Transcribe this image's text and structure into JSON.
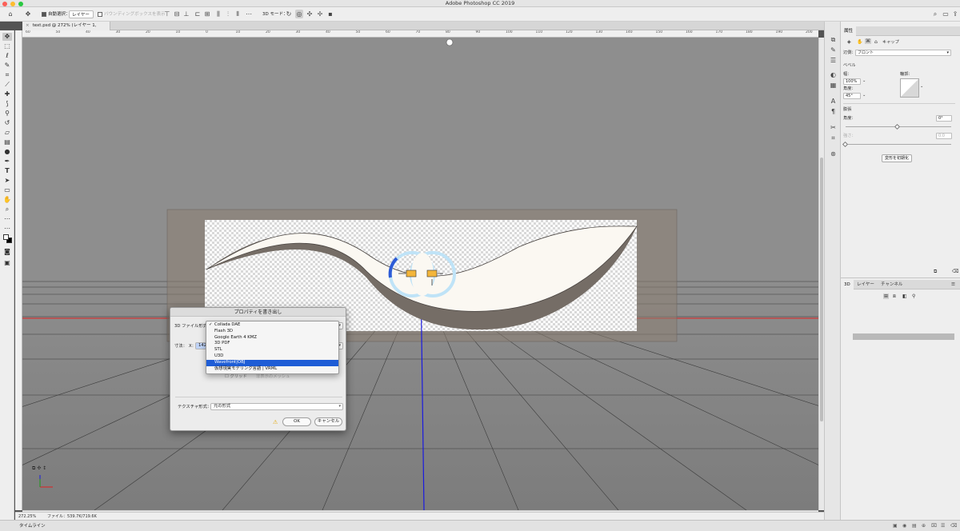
{
  "window": {
    "title": "Adobe Photoshop CC 2019"
  },
  "options_bar": {
    "auto_select_label": "自動選択：",
    "auto_select_value": "レイヤー",
    "bounding_box_label": "バウンディングボックスを表示",
    "mode_3d_label": "3D モード："
  },
  "document_tab": {
    "close": "×",
    "title": "text.psd @ 272% (レイヤー 1, RGB/8) *"
  },
  "ruler_ticks": [
    "60",
    "50",
    "40",
    "30",
    "20",
    "10",
    "0",
    "10",
    "20",
    "30",
    "40",
    "50",
    "60",
    "70",
    "80",
    "90",
    "100",
    "110",
    "120",
    "130",
    "140",
    "150",
    "160",
    "170",
    "180",
    "190",
    "200"
  ],
  "dialog": {
    "title": "プロパティを書き出し",
    "format_label": "3D ファイル形式：",
    "size_label": "寸法：",
    "x_label": "X：",
    "x_value": "142",
    "grid_label": "グリッド",
    "hidden_mesh_label": "非表示のメッシュ",
    "texture_label": "テクスチャ形式：",
    "texture_value": "元の形式",
    "ok": "OK",
    "cancel": "キャンセル",
    "warning_icon": "⚠",
    "menu_items": [
      {
        "label": "Collada DAE",
        "checked": true
      },
      {
        "label": "Flash 3D"
      },
      {
        "label": "Google Earth 4 KMZ"
      },
      {
        "label": "3D PDF"
      },
      {
        "label": "STL"
      },
      {
        "label": "U3D"
      },
      {
        "label": "Wavefront|OBJ",
        "selected": true
      },
      {
        "label": "仮想現実モデリング言語 | VRML"
      }
    ]
  },
  "status": {
    "zoom": "272.25%",
    "file_info": "ファイル：539.7K/719.6K"
  },
  "timeline": {
    "label": "タイムライン"
  },
  "properties_panel": {
    "tab": "属性",
    "cap_label": "キャップ",
    "side_label": "辺側：",
    "side_value": "フロント",
    "bevel_heading": "ベベル",
    "width_label": "幅：",
    "width_value": "100%",
    "angle_label": "角度：",
    "angle_value": "45°",
    "contour_label": "輪郭：",
    "inflate_heading": "膨張",
    "inflate_angle_label": "角度：",
    "inflate_angle_value": "0°",
    "strength_label": "強さ：",
    "strength_value": "0.0",
    "reset_button": "変形を初期化"
  },
  "panel_3d": {
    "tabs": [
      "3D",
      "レイヤー",
      "チャンネル"
    ]
  },
  "colors": {
    "accent": "#1e5dd6",
    "canvas": "#8e8e8e",
    "guide_red": "#e02020",
    "axis_blue": "#1a1ae0"
  }
}
